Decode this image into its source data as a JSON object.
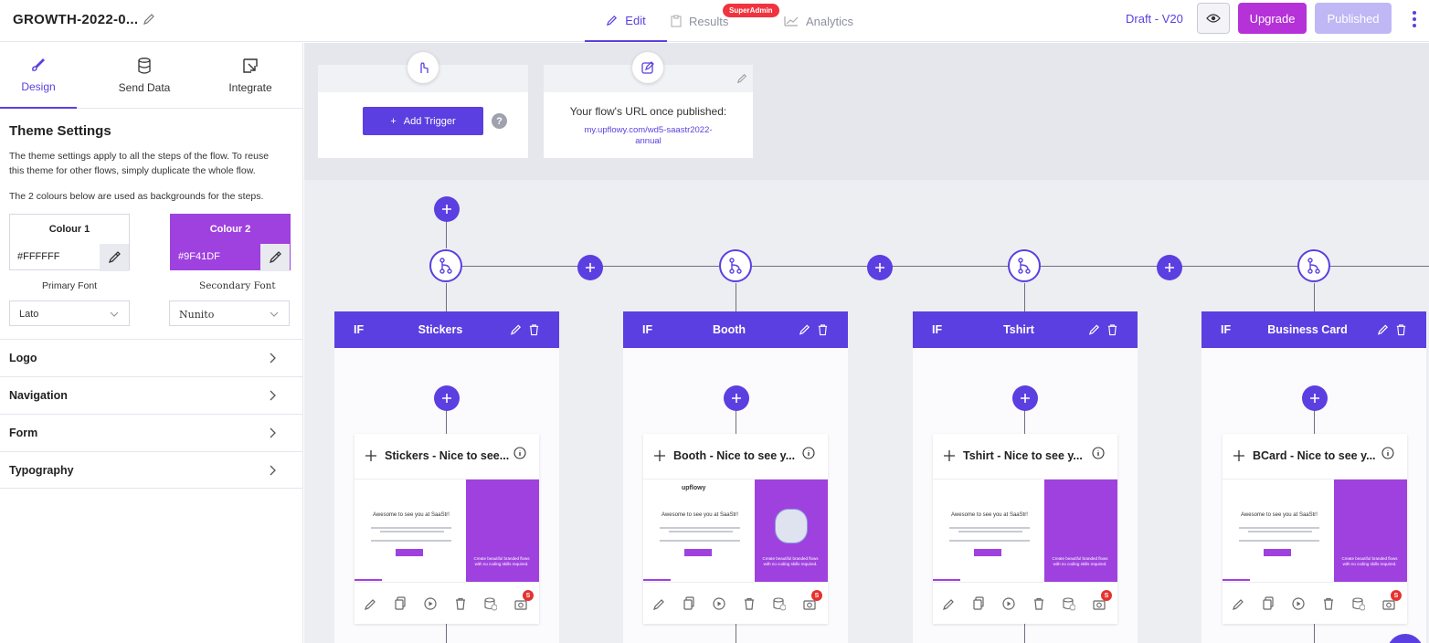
{
  "topbar": {
    "flow_title": "GROWTH-2022-0...",
    "tabs": {
      "edit": "Edit",
      "results": "Results",
      "analytics": "Analytics"
    },
    "superadmin_badge": "SuperAdmin",
    "draft_label": "Draft - V20",
    "upgrade": "Upgrade",
    "published": "Published"
  },
  "sidebar": {
    "tabs": {
      "design": "Design",
      "send_data": "Send Data",
      "integrate": "Integrate"
    },
    "theme_title": "Theme Settings",
    "theme_desc": "The theme settings apply to all the steps of the flow. To reuse this theme for other flows, simply duplicate the whole flow.",
    "theme_desc2": "The 2 colours below are used as backgrounds for the steps.",
    "colour1": {
      "label": "Colour 1",
      "hex": "#FFFFFF"
    },
    "colour2": {
      "label": "Colour 2",
      "hex": "#9F41DF"
    },
    "primary_font_label": "Primary Font",
    "secondary_font_label": "Secondary Font",
    "primary_font": "Lato",
    "secondary_font": "Nunito",
    "sections": [
      "Logo",
      "Navigation",
      "Form",
      "Typography"
    ]
  },
  "canvas": {
    "add_trigger": "Add Trigger",
    "help": "?",
    "url_title": "Your flow's URL once published:",
    "url_line1": "my.upflowy.com/wd5-saastr2022-",
    "url_line2": "annual",
    "branches": [
      {
        "if": "IF",
        "name": "Stickers",
        "step": "Stickers - Nice to see...",
        "has_logo": false
      },
      {
        "if": "IF",
        "name": "Booth",
        "step": "Booth - Nice to see y...",
        "has_logo": true
      },
      {
        "if": "IF",
        "name": "Tshirt",
        "step": "Tshirt - Nice to see y...",
        "has_logo": false
      },
      {
        "if": "IF",
        "name": "Business Card",
        "step": "BCard - Nice to see y...",
        "has_logo": false
      }
    ],
    "preview": {
      "heading": "Awesome to see you at SaaStr!",
      "cta": "Create beautiful branded flows with no coding skills required.",
      "logo": "upflowy",
      "badge": "S"
    }
  },
  "colors": {
    "accent": "#5b3fe0",
    "colour2": "#9f41df",
    "upgrade": "#b531d8",
    "published": "#c0b7f5"
  }
}
